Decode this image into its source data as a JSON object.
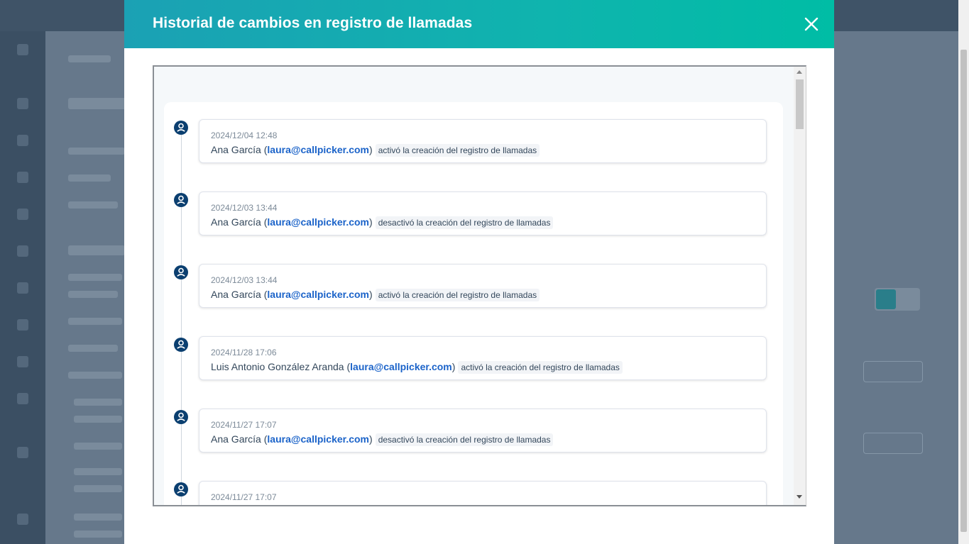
{
  "modal": {
    "title": "Historial de cambios en registro de llamadas",
    "accent_start": "#1ba1b4",
    "accent_end": "#00bda5",
    "close_icon": "close-icon"
  },
  "entries": [
    {
      "timestamp": "2024/12/04 12:48",
      "user": "Ana García",
      "open": "(",
      "email": "laura@callpicker.com",
      "close": ")",
      "action": "activó la creación del registro de llamadas"
    },
    {
      "timestamp": "2024/12/03 13:44",
      "user": "Ana García",
      "open": "(",
      "email": "laura@callpicker.com",
      "close": ")",
      "action": "desactivó la creación del registro de llamadas"
    },
    {
      "timestamp": "2024/12/03 13:44",
      "user": "Ana García",
      "open": "(",
      "email": "laura@callpicker.com",
      "close": ")",
      "action": "activó la creación del registro de llamadas"
    },
    {
      "timestamp": "2024/11/28 17:06",
      "user": "Luis Antonio González Aranda",
      "open": "(",
      "email": "laura@callpicker.com",
      "close": ")",
      "action": "activó la creación del registro de llamadas"
    },
    {
      "timestamp": "2024/11/27 17:07",
      "user": "Ana García",
      "open": "(",
      "email": "laura@callpicker.com",
      "close": ")",
      "action": "desactivó la creación del registro de llamadas"
    },
    {
      "timestamp": "2024/11/27 17:07",
      "user": "",
      "open": "",
      "email": "",
      "close": "",
      "action": ""
    }
  ]
}
